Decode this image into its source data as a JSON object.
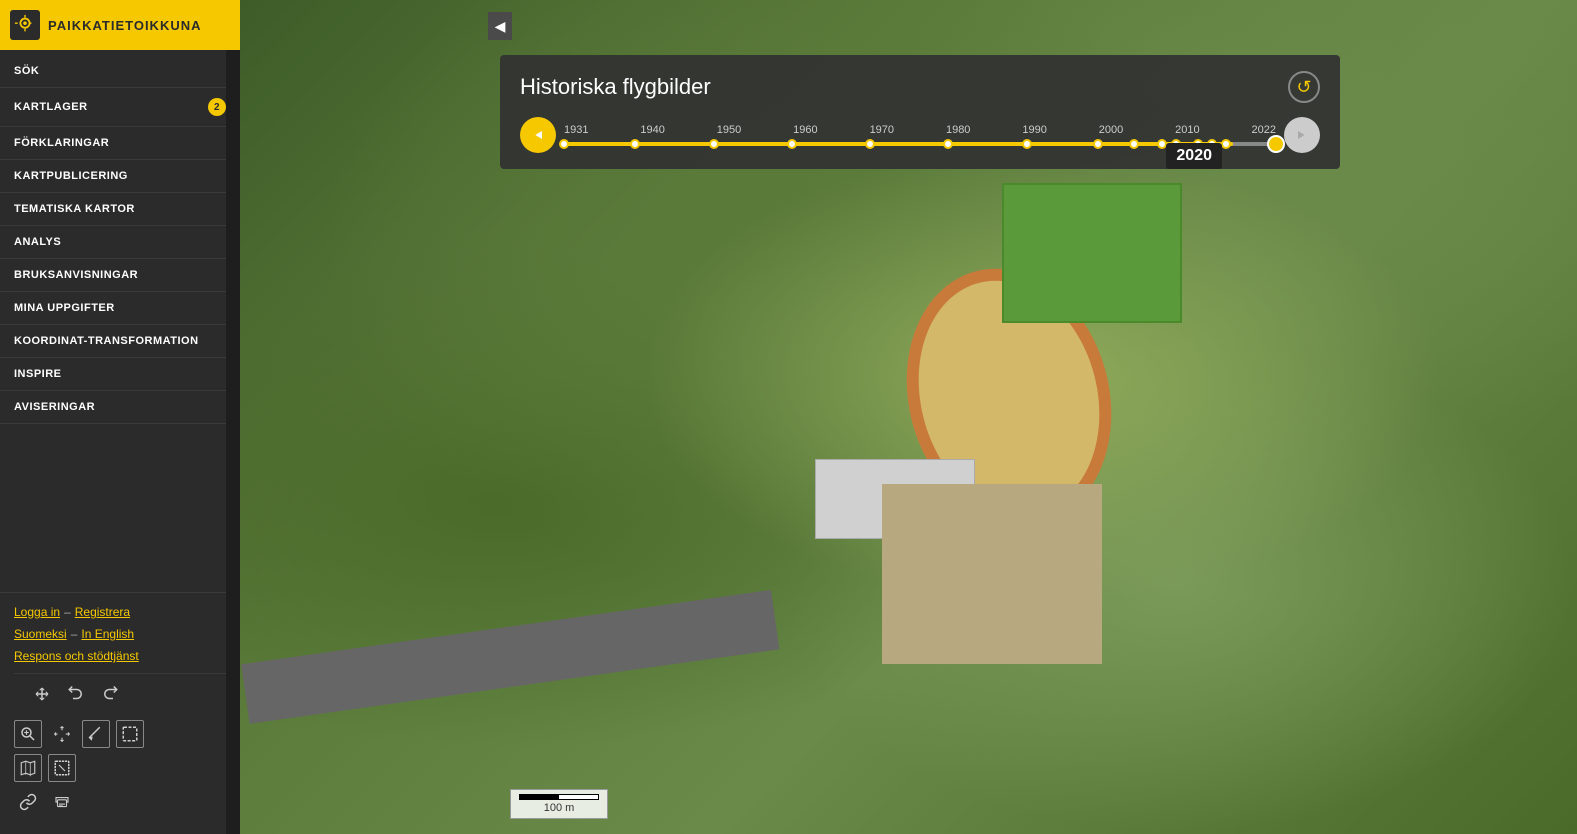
{
  "sidebar": {
    "title": "PAIKKATIETOIKKUNA",
    "nav_items": [
      {
        "id": "sok",
        "label": "SÖK",
        "badge": null
      },
      {
        "id": "kartlager",
        "label": "KARTLAGER",
        "badge": "2"
      },
      {
        "id": "forklaringar",
        "label": "FÖRKLARINGAR",
        "badge": null
      },
      {
        "id": "kartpublicering",
        "label": "KARTPUBLICERING",
        "badge": null
      },
      {
        "id": "tematiska-kartor",
        "label": "TEMATISKA KARTOR",
        "badge": null
      },
      {
        "id": "analys",
        "label": "ANALYS",
        "badge": null
      },
      {
        "id": "bruksanvisningar",
        "label": "BRUKSANVISNINGAR",
        "badge": null
      },
      {
        "id": "mina-uppgifter",
        "label": "MINA UPPGIFTER",
        "badge": null
      },
      {
        "id": "koordinat-transformation",
        "label": "KOORDINAT-TRANSFORMATION",
        "badge": null
      },
      {
        "id": "inspire",
        "label": "INSPIRE",
        "badge": null
      },
      {
        "id": "aviseringar",
        "label": "AVISERINGAR",
        "badge": null
      }
    ],
    "footer": {
      "login": "Logga in",
      "separator1": "–",
      "register": "Registrera",
      "suomeksi": "Suomeksi",
      "separator2": "–",
      "in_english": "In English",
      "support": "Respons och stödtjänst"
    }
  },
  "historic_panel": {
    "title": "Historiska flygbilder",
    "year_tooltip": "2020",
    "years": [
      "1931",
      "1940",
      "1950",
      "1960",
      "1970",
      "1980",
      "1990",
      "2000",
      "2010",
      "2022"
    ],
    "close_icon": "↺"
  },
  "collapse_button": {
    "icon": "◀"
  },
  "scale_bar": {
    "label": "100 m"
  }
}
